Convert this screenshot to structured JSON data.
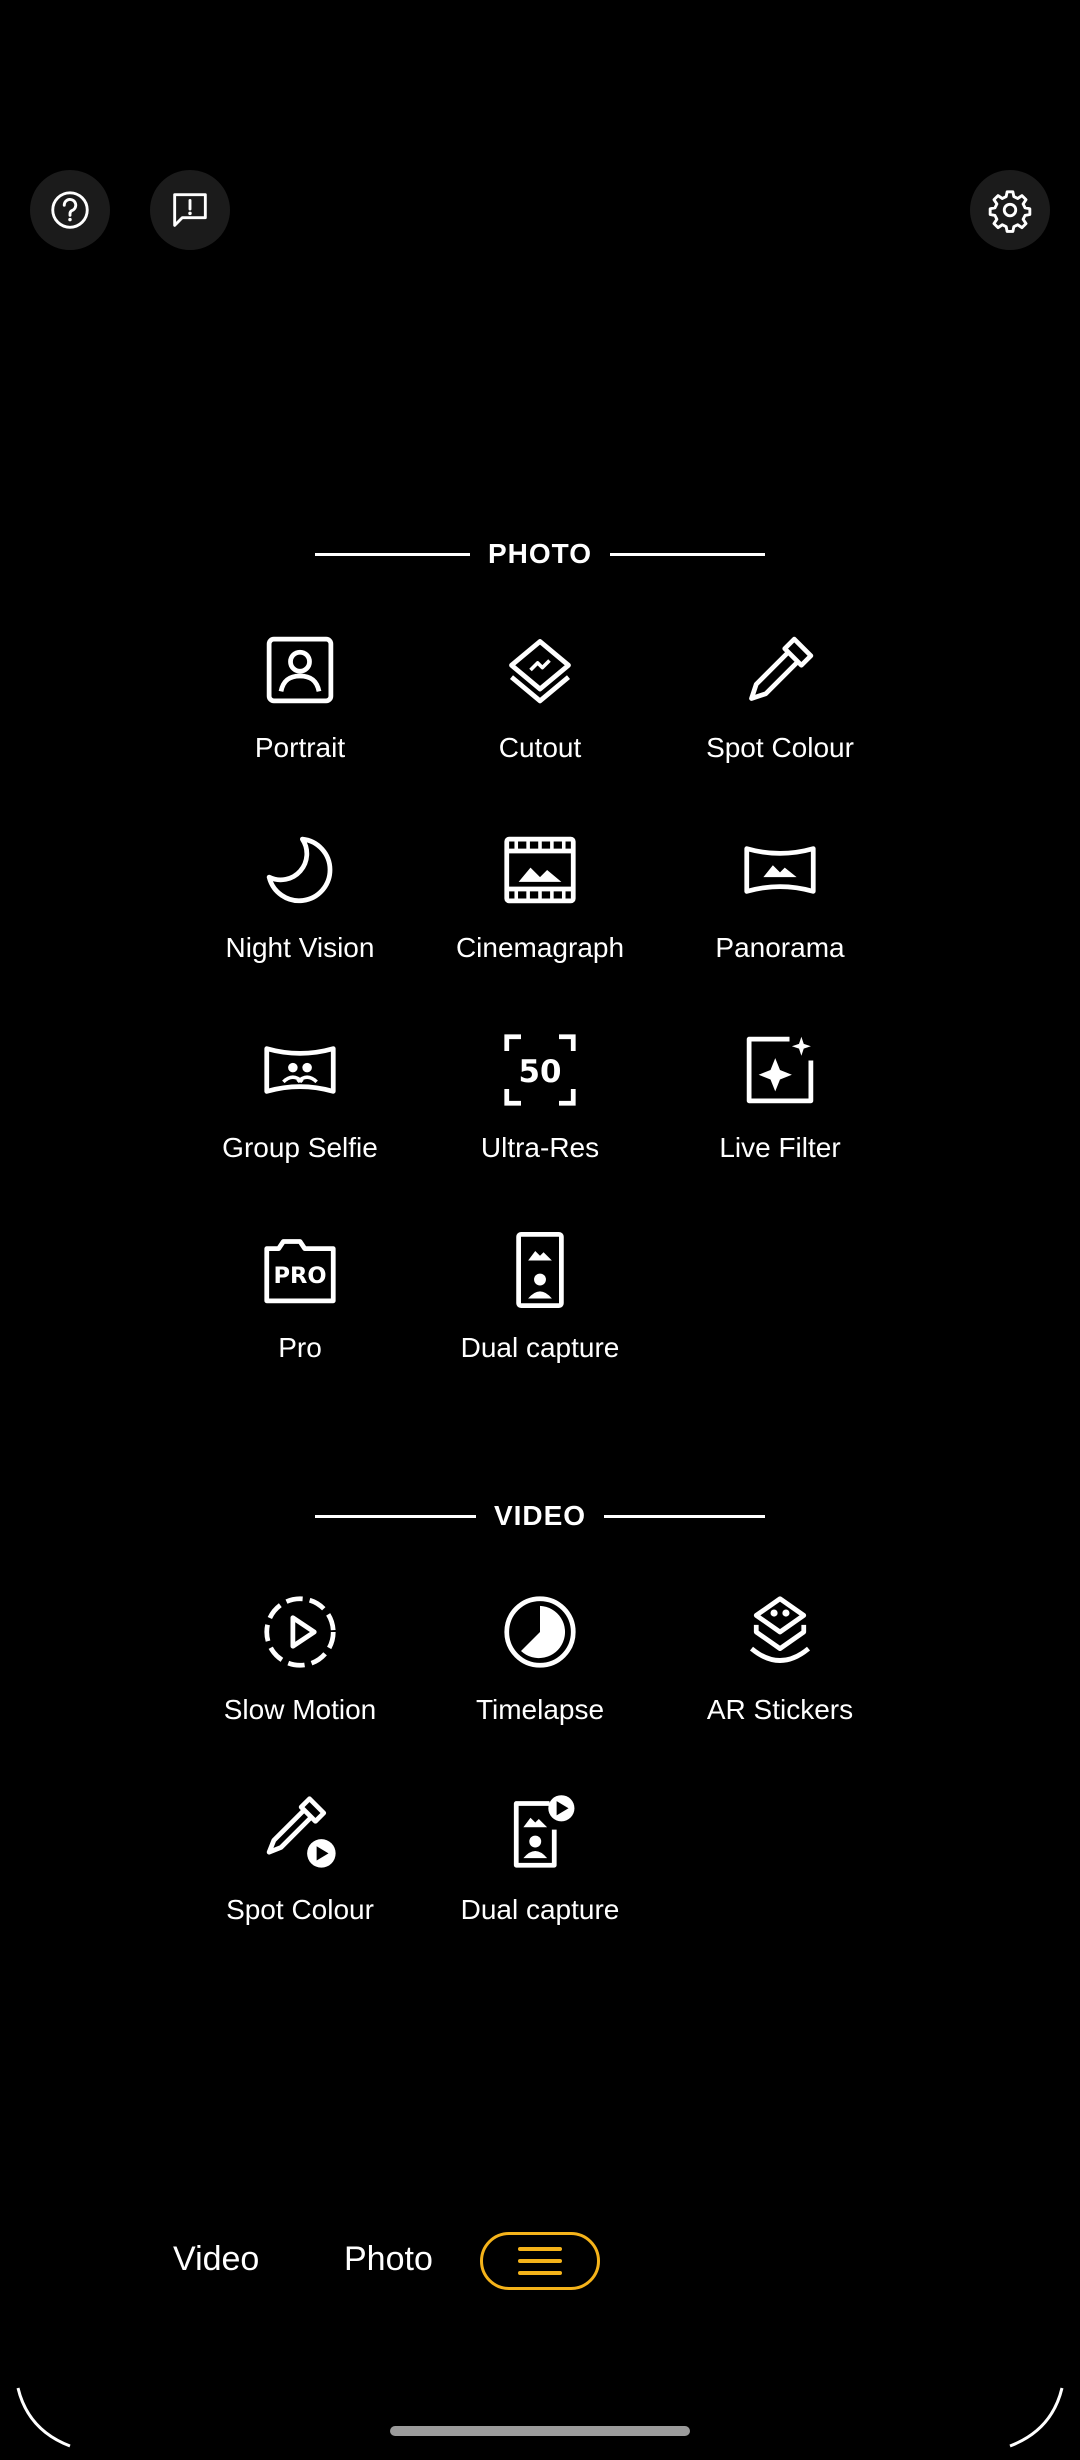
{
  "top_bar": {
    "help_icon": "help-circle-icon",
    "feedback_icon": "feedback-icon",
    "settings_icon": "gear-icon"
  },
  "photo_section": {
    "title": "PHOTO",
    "modes": [
      {
        "label": "Portrait",
        "icon": "portrait-icon"
      },
      {
        "label": "Cutout",
        "icon": "cutout-icon"
      },
      {
        "label": "Spot Colour",
        "icon": "dropper-icon"
      },
      {
        "label": "Night Vision",
        "icon": "moon-icon"
      },
      {
        "label": "Cinemagraph",
        "icon": "film-frame-icon"
      },
      {
        "label": "Panorama",
        "icon": "panorama-icon"
      },
      {
        "label": "Group Selfie",
        "icon": "group-selfie-icon"
      },
      {
        "label": "Ultra-Res",
        "icon": "ultra-res-50-icon"
      },
      {
        "label": "Live Filter",
        "icon": "sparkle-frame-icon"
      },
      {
        "label": "Pro",
        "icon": "pro-camera-icon"
      },
      {
        "label": "Dual capture",
        "icon": "dual-capture-icon"
      }
    ]
  },
  "video_section": {
    "title": "VIDEO",
    "modes": [
      {
        "label": "Slow Motion",
        "icon": "slow-motion-icon"
      },
      {
        "label": "Timelapse",
        "icon": "timelapse-icon"
      },
      {
        "label": "AR Stickers",
        "icon": "ar-stickers-icon"
      },
      {
        "label": "Spot Colour",
        "icon": "dropper-play-icon"
      },
      {
        "label": "Dual capture",
        "icon": "dual-capture-play-icon"
      }
    ]
  },
  "bottom_tabs": {
    "video_label": "Video",
    "photo_label": "Photo",
    "menu_icon": "hamburger-menu-icon"
  },
  "colors": {
    "accent": "#f5b31a",
    "background": "#000000",
    "button_bg": "#1b1b1b"
  }
}
